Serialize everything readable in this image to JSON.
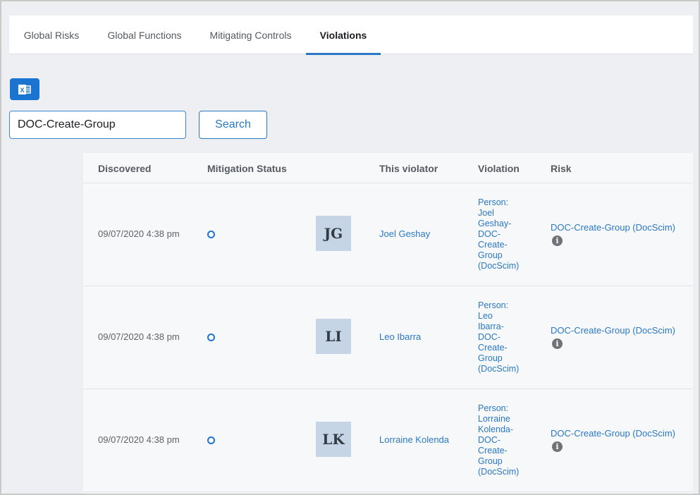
{
  "tabs": [
    {
      "label": "Global Risks",
      "active": false
    },
    {
      "label": "Global Functions",
      "active": false
    },
    {
      "label": "Mitigating Controls",
      "active": false
    },
    {
      "label": "Violations",
      "active": true
    }
  ],
  "toolbar": {
    "excel_icon_name": "excel-export-icon",
    "excel_label": "X"
  },
  "search": {
    "value": "DOC-Create-Group",
    "button_label": "Search"
  },
  "table": {
    "columns": [
      "Discovered",
      "Mitigation Status",
      "This violator",
      "Violation",
      "Risk"
    ],
    "rows": [
      {
        "discovered": "09/07/2020 4:38 pm",
        "status_icon": "circle-open",
        "initials": "JG",
        "violator": "Joel Geshay",
        "violation_lines": [
          "Person:",
          "Joel",
          "Geshay-",
          "DOC-",
          "Create-",
          "Group",
          "(DocScim)"
        ],
        "risk": "DOC-Create-Group (DocScim)"
      },
      {
        "discovered": "09/07/2020 4:38 pm",
        "status_icon": "circle-open",
        "initials": "LI",
        "violator": "Leo Ibarra",
        "violation_lines": [
          "Person:",
          "Leo",
          "Ibarra-",
          "DOC-",
          "Create-",
          "Group",
          "(DocScim)"
        ],
        "risk": "DOC-Create-Group (DocScim)"
      },
      {
        "discovered": "09/07/2020 4:38 pm",
        "status_icon": "circle-open",
        "initials": "LK",
        "violator": "Lorraine Kolenda",
        "violation_lines": [
          "Person:",
          "Lorraine",
          "Kolenda-",
          "DOC-",
          "Create-",
          "Group",
          "(DocScim)"
        ],
        "risk": "DOC-Create-Group (DocScim)"
      }
    ]
  },
  "colors": {
    "accent": "#2a78c4",
    "excel_button": "#1b74cf",
    "avatar_bg": "#c5d5e6",
    "status_dot": "#1a74d1"
  }
}
